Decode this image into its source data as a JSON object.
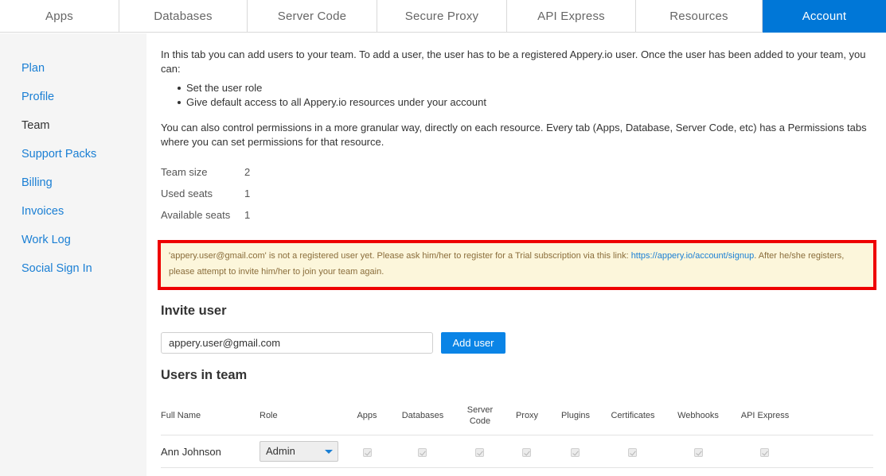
{
  "topnav": {
    "tabs": [
      {
        "label": "Apps",
        "active": false
      },
      {
        "label": "Databases",
        "active": false
      },
      {
        "label": "Server Code",
        "active": false
      },
      {
        "label": "Secure Proxy",
        "active": false
      },
      {
        "label": "API Express",
        "active": false
      },
      {
        "label": "Resources",
        "active": false
      },
      {
        "label": "Account",
        "active": true
      }
    ]
  },
  "sidebar": {
    "items": [
      {
        "label": "Plan"
      },
      {
        "label": "Profile"
      },
      {
        "label": "Team",
        "current": true
      },
      {
        "label": "Support Packs"
      },
      {
        "label": "Billing"
      },
      {
        "label": "Invoices"
      },
      {
        "label": "Work Log"
      },
      {
        "label": "Social Sign In"
      }
    ]
  },
  "main": {
    "intro": "In this tab you can add users to your team. To add a user, the user has to be a registered Appery.io user. Once the user has been added to your team, you can:",
    "bullets": [
      "Set the user role",
      "Give default access to all Appery.io resources under your account"
    ],
    "permissions_text": "You can also control permissions in a more granular way, directly on each resource. Every tab (Apps, Database, Server Code, etc) has a Permissions tabs where you can set permissions for that resource.",
    "stats": [
      {
        "label": "Team size",
        "value": "2"
      },
      {
        "label": "Used seats",
        "value": "1"
      },
      {
        "label": "Available seats",
        "value": "1"
      }
    ],
    "alert": {
      "text_before": "'appery.user@gmail.com' is not a registered user yet. Please ask him/her to register for a Trial subscription via this link: ",
      "link": "https://appery.io/account/signup",
      "text_after": ". After he/she registers, please attempt to invite him/her to join your team again."
    },
    "invite": {
      "heading": "Invite user",
      "input_value": "appery.user@gmail.com",
      "button_label": "Add user"
    },
    "team": {
      "heading": "Users in team",
      "columns": [
        "Full Name",
        "Role",
        "Apps",
        "Databases",
        "Server Code",
        "Proxy",
        "Plugins",
        "Certificates",
        "Webhooks",
        "API Express"
      ],
      "rows": [
        {
          "name": "Ann Johnson",
          "role": "Admin"
        }
      ]
    }
  },
  "colors": {
    "accent": "#0077d7",
    "link": "#1a7fd4",
    "alert_bg": "#fcf6db",
    "alert_border": "#ee0000"
  }
}
